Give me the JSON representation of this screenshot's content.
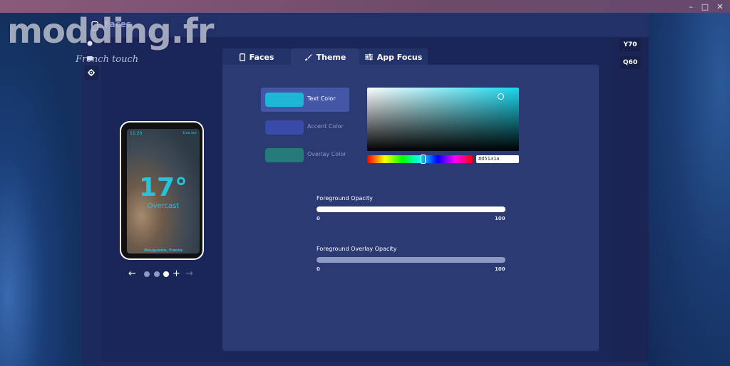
{
  "window_controls": {
    "minimize": "–",
    "maximize": "□",
    "close": "✕"
  },
  "watermark": {
    "title": "modding.fr",
    "subtitle": "French touch"
  },
  "app": {
    "title": "Faces"
  },
  "rail": [
    {
      "icon": "phone-icon"
    },
    {
      "icon": "drag-icon"
    },
    {
      "icon": "layers-icon"
    },
    {
      "icon": "gear-icon"
    }
  ],
  "devices": [
    {
      "label": "Y70"
    },
    {
      "label": "Q60"
    }
  ],
  "tabs": [
    {
      "label": "Faces",
      "icon": "phone-icon",
      "active": false
    },
    {
      "label": "Theme",
      "icon": "brush-icon",
      "active": true
    },
    {
      "label": "App Focus",
      "icon": "sliders-icon",
      "active": false
    }
  ],
  "colors": [
    {
      "label": "Text Color",
      "hex": "#1db6d4",
      "selected": true
    },
    {
      "label": "Accent Color",
      "hex": "#3a4aa8",
      "selected": false
    },
    {
      "label": "Overlay Color",
      "hex": "#277a7a",
      "selected": false
    }
  ],
  "picker": {
    "hex_value": "#d51a1a"
  },
  "sliders": [
    {
      "label": "Foreground Opacity",
      "min": "0",
      "max": "100",
      "value": 100,
      "color": "#ffffff"
    },
    {
      "label": "Foreground Overlay Opacity",
      "min": "0",
      "max": "100",
      "value": 100,
      "color": "#8f9ac4"
    }
  ],
  "phone": {
    "time": "11:20",
    "live_label": "Live sur",
    "temperature": "17°",
    "condition": "Overcast",
    "location": "Mougueste, France"
  },
  "pager": {
    "count": 3,
    "active_index": 2,
    "prev": "←",
    "add": "+",
    "next": "→"
  }
}
